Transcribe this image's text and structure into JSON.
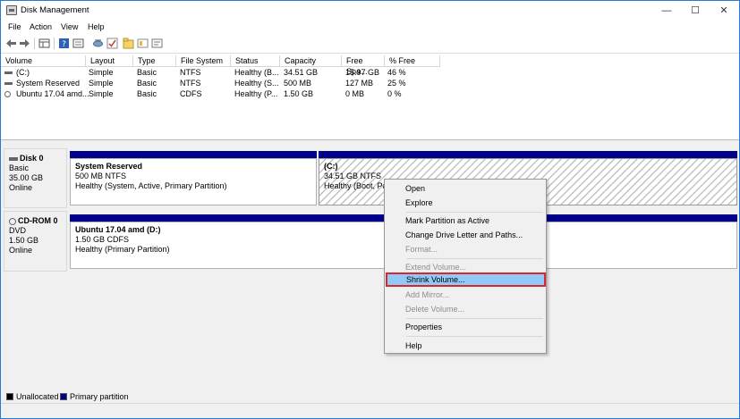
{
  "window": {
    "title": "Disk Management",
    "controls": {
      "minimize": "—",
      "maximize": "☐",
      "close": "✕"
    }
  },
  "menu": [
    "File",
    "Action",
    "View",
    "Help"
  ],
  "toolbar": {
    "buttons": [
      "back-icon",
      "forward-icon",
      "disk-list-icon",
      "help-icon",
      "properties-icon",
      "connect-icon",
      "check-icon",
      "folder-icon",
      "drive-icon",
      "settings-icon"
    ]
  },
  "volumes": {
    "columns": [
      "Volume",
      "Layout",
      "Type",
      "File System",
      "Status",
      "Capacity",
      "Free Spa...",
      "% Free"
    ],
    "rows": [
      [
        "(C:)",
        "Simple",
        "Basic",
        "NTFS",
        "Healthy (B...",
        "34.51 GB",
        "15.97 GB",
        "46 %"
      ],
      [
        "System Reserved",
        "Simple",
        "Basic",
        "NTFS",
        "Healthy (S...",
        "500 MB",
        "127 MB",
        "25 %"
      ],
      [
        "Ubuntu 17.04 amd...",
        "Simple",
        "Basic",
        "CDFS",
        "Healthy (P...",
        "1.50 GB",
        "0 MB",
        "0 %"
      ]
    ]
  },
  "disks": [
    {
      "name": "Disk 0",
      "type": "Basic",
      "size": "35.00 GB",
      "status": "Online",
      "partitions": [
        {
          "name": "System Reserved",
          "size": "500 MB NTFS",
          "status": "Healthy (System, Active, Primary Partition)"
        },
        {
          "name": "(C:)",
          "size": "34.51 GB NTFS",
          "status": "Healthy (Boot, Pa"
        }
      ]
    },
    {
      "name": "CD-ROM 0",
      "type": "DVD",
      "size": "1.50 GB",
      "status": "Online",
      "partitions": [
        {
          "name": "Ubuntu 17.04 amd  (D:)",
          "size": "1.50 GB CDFS",
          "status": "Healthy (Primary Partition)"
        }
      ]
    }
  ],
  "context_menu": {
    "items": [
      {
        "label": "Open",
        "enabled": true
      },
      {
        "label": "Explore",
        "enabled": true
      },
      {
        "label": "Mark Partition as Active",
        "enabled": true
      },
      {
        "label": "Change Drive Letter and Paths...",
        "enabled": true
      },
      {
        "label": "Format...",
        "enabled": false
      },
      {
        "label": "Extend Volume...",
        "enabled": false
      },
      {
        "label": "Shrink Volume...",
        "enabled": true,
        "highlighted": true
      },
      {
        "label": "Add Mirror...",
        "enabled": false
      },
      {
        "label": "Delete Volume...",
        "enabled": false
      },
      {
        "label": "Properties",
        "enabled": true
      },
      {
        "label": "Help",
        "enabled": true
      }
    ]
  },
  "legend": {
    "unallocated": "Unallocated",
    "primary": "Primary partition"
  },
  "colors": {
    "primary_partition": "#00008b",
    "unallocated": "#000000",
    "highlight": "#91c9f7",
    "highlight_border": "#d9262b"
  }
}
